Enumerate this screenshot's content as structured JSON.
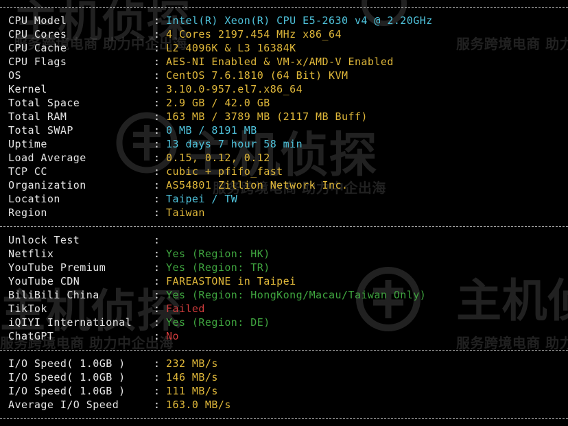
{
  "system_info": [
    {
      "label": "CPU Model",
      "value": "Intel(R) Xeon(R) CPU E5-2630 v4 @ 2.20GHz",
      "color": "cyan"
    },
    {
      "label": "CPU Cores",
      "value": "4 Cores 2197.454 MHz x86_64",
      "color": "yellow"
    },
    {
      "label": "CPU Cache",
      "value": "L2 4096K & L3 16384K",
      "color": "yellow"
    },
    {
      "label": "CPU Flags",
      "value": "AES-NI Enabled & VM-x/AMD-V Enabled",
      "color": "yellow"
    },
    {
      "label": "OS",
      "value": "CentOS 7.6.1810 (64 Bit) KVM",
      "color": "yellow"
    },
    {
      "label": "Kernel",
      "value": "3.10.0-957.el7.x86_64",
      "color": "yellow"
    },
    {
      "label": "Total Space",
      "value": "2.9 GB / 42.0 GB",
      "color": "yellow"
    },
    {
      "label": "Total RAM",
      "value": "163 MB / 3789 MB (2117 MB Buff)",
      "color": "yellow"
    },
    {
      "label": "Total SWAP",
      "value": "0 MB / 8191 MB",
      "color": "cyan"
    },
    {
      "label": "Uptime",
      "value": "13 days 7 hour 58 min",
      "color": "cyan"
    },
    {
      "label": "Load Average",
      "value": "0.15, 0.12, 0.12",
      "color": "yellow"
    },
    {
      "label": "TCP CC",
      "value": "cubic + pfifo_fast",
      "color": "yellow"
    },
    {
      "label": "Organization",
      "value": "AS54801 Zillion Network Inc.",
      "color": "yellow"
    },
    {
      "label": "Location",
      "value": "Taipei / TW",
      "color": "cyan"
    },
    {
      "label": "Region",
      "value": "Taiwan",
      "color": "yellow"
    }
  ],
  "unlock_test": [
    {
      "label": "Unlock Test",
      "value": "",
      "color": "white"
    },
    {
      "label": "Netflix",
      "value": "Yes (Region: HK)",
      "color": "green"
    },
    {
      "label": "YouTube Premium",
      "value": "Yes (Region: TR)",
      "color": "green"
    },
    {
      "label": "YouTube CDN",
      "value": "FAREASTONE in Taipei",
      "color": "yellow"
    },
    {
      "label": "BiliBili China",
      "value": "Yes (Region: HongKong/Macau/Taiwan Only)",
      "color": "green"
    },
    {
      "label": "TikTok",
      "value": "Failed",
      "color": "red"
    },
    {
      "label": "iQIYI International",
      "value": "Yes (Region: DE)",
      "color": "green"
    },
    {
      "label": "ChatGPT",
      "value": "No",
      "color": "red"
    }
  ],
  "io_speed": [
    {
      "label": "I/O Speed( 1.0GB )",
      "value": "232 MB/s",
      "color": "yellow"
    },
    {
      "label": "I/O Speed( 1.0GB )",
      "value": "146 MB/s",
      "color": "yellow"
    },
    {
      "label": "I/O Speed( 1.0GB )",
      "value": "111 MB/s",
      "color": "yellow"
    },
    {
      "label": "Average I/O Speed",
      "value": "163.0 MB/s",
      "color": "yellow"
    }
  ],
  "colon": ":",
  "watermark": {
    "brand": "主机侦探",
    "slogan": "服务跨境电商 助力中企出海"
  }
}
